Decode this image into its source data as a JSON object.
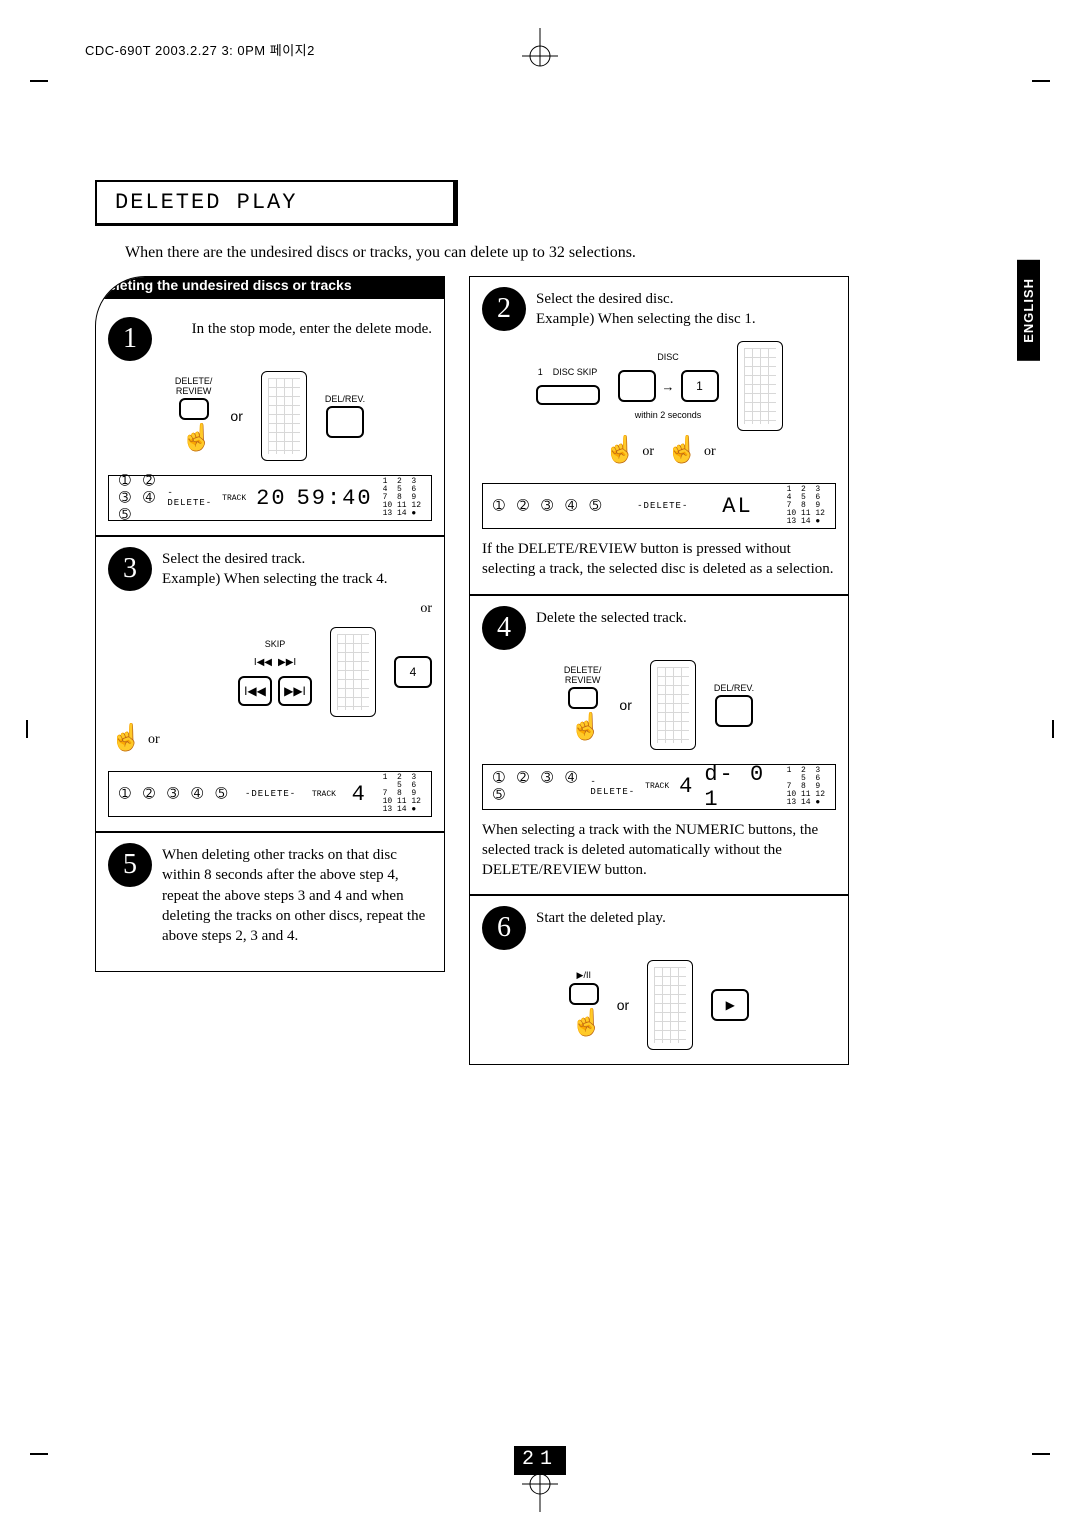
{
  "meta": {
    "header": "CDC-690T 2003.2.27 3: 0PM 페이지2"
  },
  "side_tab": "ENGLISH",
  "title": "DELETED PLAY",
  "intro": "When there are the undesired discs or tracks, you can delete up to 32 selections.",
  "banner": "Deleting the undesired discs or tracks",
  "labels": {
    "or": "or",
    "del_rev": "DEL/REV.",
    "delete_review": "DELETE/\nREVIEW",
    "skip": "SKIP",
    "disc": "DISC",
    "disc_skip": "DISC SKIP",
    "within2s": "within 2 seconds",
    "track": "TRACK",
    "delete_ind": "-DELETE-",
    "play_pause": "▶/II"
  },
  "steps": {
    "s1": {
      "num": "1",
      "text": "In the stop mode, enter the delete mode."
    },
    "s2": {
      "num": "2",
      "text1": "Select the desired disc.",
      "text2": "Example) When selecting the disc 1."
    },
    "s3": {
      "num": "3",
      "text1": "Select the desired track.",
      "text2": "Example) When selecting the track 4."
    },
    "s4": {
      "num": "4",
      "text1": "Delete the selected track."
    },
    "s5": {
      "num": "5",
      "text": "When deleting other tracks on that disc within 8 seconds after the above step 4, repeat the above steps 3 and 4 and when deleting the tracks on other discs, repeat the above steps 2, 3 and 4."
    },
    "s6": {
      "num": "6",
      "text": "Start the deleted play."
    }
  },
  "notes": {
    "n2": "If the DELETE/REVIEW button is pressed without selecting a track, the selected disc is deleted as a selection.",
    "n4": "When selecting a track with the NUMERIC buttons, the selected track is deleted automatically without the DELETE/REVIEW button."
  },
  "lcd": {
    "discs_row": "➀ ➁ ➂ ➃ ➄",
    "nums_grid": "1  2  3\n4  5  6\n7  8  9\n10 11 12\n13 14 ●",
    "nums_grid_no4": "1  2  3\n   5  6\n7  8  9\n10 11 12\n13 14 ●",
    "step1_track": "20",
    "step1_time": "59:40",
    "step2_seg": "AL",
    "step3_seg": "4",
    "step4_track": "4",
    "step4_seg": "d- 0 1",
    "disc1_key": "1",
    "track4_key": "4",
    "play_key": "▶",
    "skip_prev": "I◀◀",
    "skip_next": "▶▶I",
    "panel_prev": "I◀◀",
    "panel_next": "▶▶I"
  },
  "page_number": "21"
}
